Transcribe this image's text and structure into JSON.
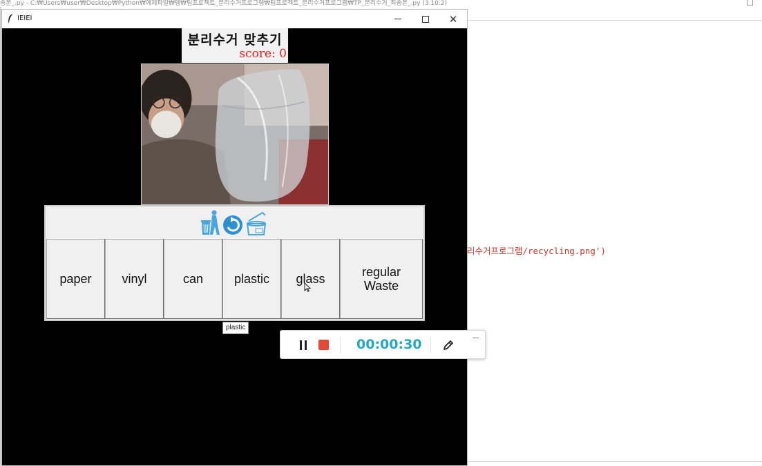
{
  "background_editor": {
    "title": "종본_.py - C:₩Users₩user₩Desktop₩Python₩에제파일₩템₩팀프로젝트_분리수거프로그램₩팀프로젝트_분리수거프로그램₩TP_분리수거_최종본_.py (3.10.2)",
    "code_line": "리수거프로그램/recycling.png')"
  },
  "window": {
    "title": "IEIEI",
    "minimize_glyph": "",
    "maximize_glyph": "",
    "close_glyph": "✕"
  },
  "game": {
    "title": "분리수거 맞추기",
    "score_label": "score:",
    "score_value": "0"
  },
  "categories": [
    {
      "label": "paper"
    },
    {
      "label": "vinyl"
    },
    {
      "label": "can"
    },
    {
      "label": "plastic"
    },
    {
      "label": "glass"
    },
    {
      "label": "regular\nWaste"
    }
  ],
  "tooltip": "plastic",
  "icons": [
    "recycle-bin-person-icon",
    "recycle-arrow-icon",
    "open-can-icon"
  ],
  "recorder": {
    "time": "00:00:30",
    "minimize": "—"
  },
  "colors": {
    "score": "#e02020",
    "timer": "#27a6c4",
    "stop": "#e04a36",
    "icon_blue": "#4aa6d8"
  }
}
